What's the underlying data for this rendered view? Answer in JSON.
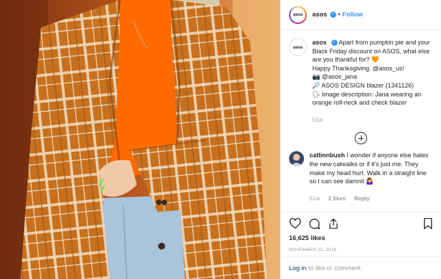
{
  "post": {
    "account": "asos",
    "avatar_text": "asos",
    "follow_label": "Follow",
    "dot": "•"
  },
  "caption": {
    "username": "asos",
    "line1": "Apart from pumpkin pie and your Black Friday discount on ASOS, what else are you thankful for? 🧡",
    "line2": "Happy Thanksgiving. @asos_us!",
    "line3": "📷 @asos_jana",
    "line4": "🔎 ASOS DESIGN blazer (1341126)",
    "line5": "🗣 Image description: Jana wearing an orange roll-neck and check blazer",
    "time": "51w"
  },
  "comment": {
    "username": "catlinnbush",
    "text": "I wonder if anyone else hates the new catwalks or if it's just me. They make my head hurt. Walk in a straight line so I can see damnit 🤷‍♀️",
    "time": "51w",
    "likes": "2 likes",
    "reply": "Reply"
  },
  "engagement": {
    "likes": "16,625 likes",
    "date": "NOVEMBER 22, 2018"
  },
  "login": {
    "link": "Log in",
    "rest": "to like or comment."
  },
  "icons": {
    "heart": "heart-icon",
    "comment": "comment-icon",
    "share": "share-icon",
    "save": "bookmark-icon",
    "verified": "verified-badge-icon",
    "load_more": "plus-circle-icon"
  },
  "colors": {
    "link": "#3897f0",
    "muted": "#999999",
    "blazer": "#c8731f",
    "turtleneck": "#ff6a00"
  }
}
